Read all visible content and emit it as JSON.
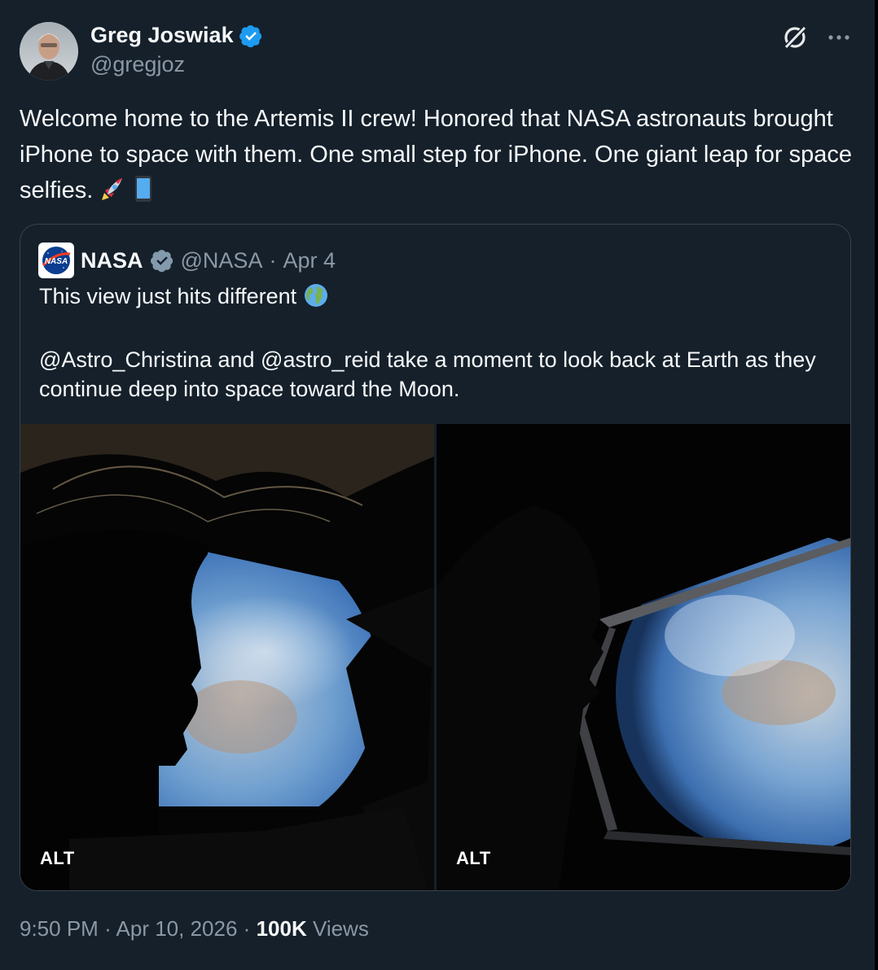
{
  "author": {
    "name": "Greg Joswiak",
    "handle": "@gregjoz",
    "verified_icon": "verified-badge-icon"
  },
  "tweet": {
    "text": "Welcome home to the Artemis II crew! Honored that NASA astronauts brought iPhone to space with them. One small step for iPhone. One giant leap for space selfies.",
    "emojis": [
      "rocket-emoji",
      "mobile-phone-emoji"
    ]
  },
  "quote": {
    "name": "NASA",
    "logo_text": "NASA",
    "handle": "@NASA",
    "separator": "·",
    "date": "Apr 4",
    "line1": "This view just hits different",
    "line2": "@Astro_Christina and @astro_reid take a moment to look back at Earth as they continue deep into space toward the Moon.",
    "media": [
      {
        "alt_label": "ALT"
      },
      {
        "alt_label": "ALT"
      }
    ]
  },
  "footer": {
    "time": "9:50 PM",
    "sep1": "·",
    "date": "Apr 10, 2026",
    "sep2": "·",
    "views_count": "100K",
    "views_label": "Views"
  },
  "colors": {
    "background": "#15202b",
    "text": "#f7f9f9",
    "muted": "#8b98a5",
    "border": "#38444d",
    "verified_blue": "#1d9bf0"
  }
}
